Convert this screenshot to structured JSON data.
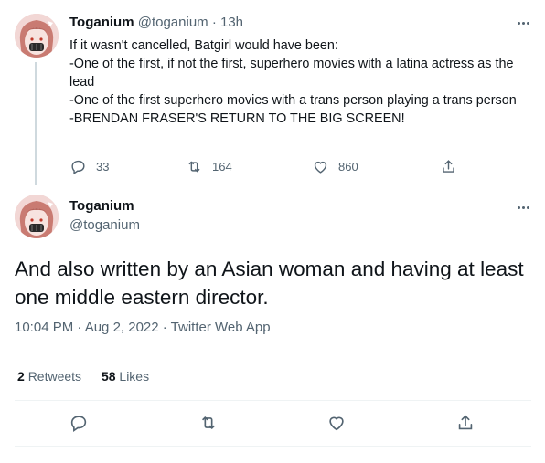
{
  "reply": {
    "name": "Toganium",
    "handle": "@toganium",
    "separator": "·",
    "time": "13h",
    "lines": [
      "If it wasn't cancelled, Batgirl would have been:",
      "-One of the first, if not the first, superhero movies with a latina actress as the lead",
      "-One of the first superhero movies with a trans person playing a trans person",
      "-BRENDAN FRASER'S RETURN TO THE BIG SCREEN!"
    ],
    "reply_count": "33",
    "retweet_count": "164",
    "like_count": "860"
  },
  "main": {
    "name": "Toganium",
    "handle": "@toganium",
    "text": "And also written by an Asian woman and having at least one middle eastern director.",
    "meta": "10:04 PM · Aug 2, 2022 · Twitter Web App",
    "retweets_value": "2",
    "retweets_label": "Retweets",
    "likes_value": "58",
    "likes_label": "Likes"
  },
  "icons": {
    "reply": "reply-icon",
    "retweet": "retweet-icon",
    "like": "heart-icon",
    "share": "share-icon",
    "more": "more-icon"
  },
  "colors": {
    "text": "#0f1419",
    "secondary": "#536471",
    "divider": "#eff3f4",
    "thread_line": "#cfd9de"
  }
}
